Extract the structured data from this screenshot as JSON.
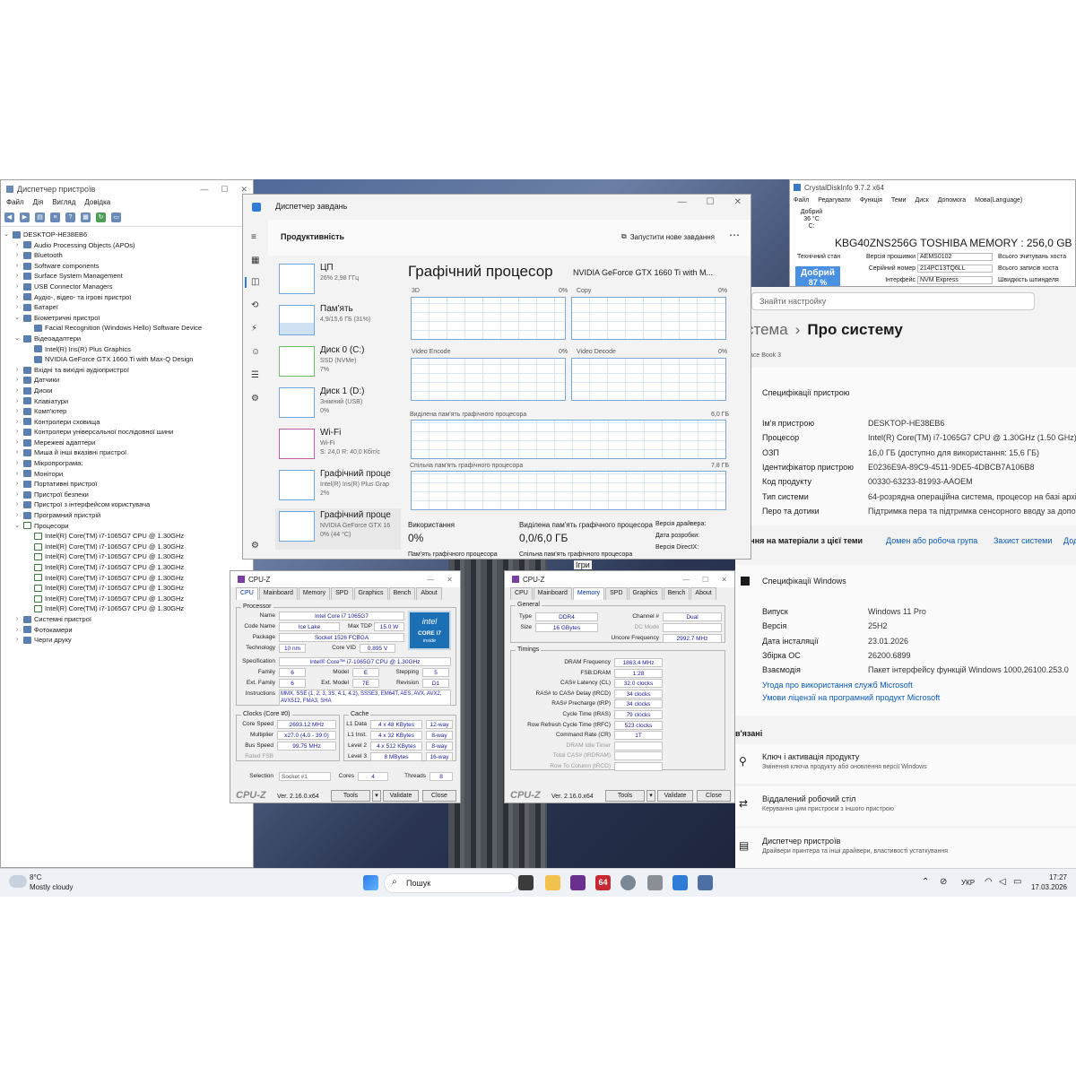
{
  "device_manager": {
    "title": "Диспетчер пристроїв",
    "menu": [
      "Файл",
      "Дія",
      "Вигляд",
      "Довідка"
    ],
    "tree": [
      {
        "label": "DESKTOP-HE38EB6",
        "level": 0,
        "toggle": "v",
        "icon": "computer-icon"
      },
      {
        "label": "Audio Processing Objects (APOs)",
        "level": 1,
        "toggle": ">",
        "icon": "audio-icon"
      },
      {
        "label": "Bluetooth",
        "level": 1,
        "toggle": ">",
        "icon": "bluetooth-icon"
      },
      {
        "label": "Software components",
        "level": 1,
        "toggle": ">",
        "icon": "component-icon"
      },
      {
        "label": "Surface System Management",
        "level": 1,
        "toggle": ">",
        "icon": "surface-icon"
      },
      {
        "label": "USB Connector Managers",
        "level": 1,
        "toggle": ">",
        "icon": "usb-icon"
      },
      {
        "label": "Аудіо-, відео- та ігрові пристрої",
        "level": 1,
        "toggle": ">",
        "icon": "speaker-icon"
      },
      {
        "label": "Батареї",
        "level": 1,
        "toggle": ">",
        "icon": "battery-icon"
      },
      {
        "label": "Біометричні пристрої",
        "level": 1,
        "toggle": "v",
        "icon": "biometric-icon"
      },
      {
        "label": "Facial Recognition (Windows Hello) Software Device",
        "level": 2,
        "toggle": "",
        "icon": "biometric-icon"
      },
      {
        "label": "Відеоадаптери",
        "level": 1,
        "toggle": "v",
        "icon": "display-adapter-icon"
      },
      {
        "label": "Intel(R) Iris(R) Plus Graphics",
        "level": 2,
        "toggle": "",
        "icon": "display-adapter-icon"
      },
      {
        "label": "NVIDIA GeForce GTX 1660 Ti with Max-Q Design",
        "level": 2,
        "toggle": "",
        "icon": "display-adapter-icon"
      },
      {
        "label": "Вхідні та вихідні аудіопристрої",
        "level": 1,
        "toggle": ">",
        "icon": "audio-io-icon"
      },
      {
        "label": "Датчики",
        "level": 1,
        "toggle": ">",
        "icon": "sensor-icon"
      },
      {
        "label": "Диски",
        "level": 1,
        "toggle": ">",
        "icon": "disk-icon"
      },
      {
        "label": "Клавіатури",
        "level": 1,
        "toggle": ">",
        "icon": "keyboard-icon"
      },
      {
        "label": "Комп'ютер",
        "level": 1,
        "toggle": ">",
        "icon": "computer-icon"
      },
      {
        "label": "Контролери сховища",
        "level": 1,
        "toggle": ">",
        "icon": "storage-icon"
      },
      {
        "label": "Контролери універсальної послідовної шини",
        "level": 1,
        "toggle": ">",
        "icon": "usb-icon"
      },
      {
        "label": "Мережеві адаптери",
        "level": 1,
        "toggle": ">",
        "icon": "network-icon"
      },
      {
        "label": "Миша й інші вказівні пристрої",
        "level": 1,
        "toggle": ">",
        "icon": "mouse-icon"
      },
      {
        "label": "Мікропрограма:",
        "level": 1,
        "toggle": ">",
        "icon": "firmware-icon"
      },
      {
        "label": "Монітори",
        "level": 1,
        "toggle": ">",
        "icon": "monitor-icon"
      },
      {
        "label": "Портативні пристрої",
        "level": 1,
        "toggle": ">",
        "icon": "portable-icon"
      },
      {
        "label": "Пристрої безпеки",
        "level": 1,
        "toggle": ">",
        "icon": "security-icon"
      },
      {
        "label": "Пристрої з інтерфейсом користувача",
        "level": 1,
        "toggle": ">",
        "icon": "hid-icon"
      },
      {
        "label": "Програмний пристрій",
        "level": 1,
        "toggle": ">",
        "icon": "software-device-icon"
      },
      {
        "label": "Процесори",
        "level": 1,
        "toggle": "v",
        "icon": "processor-icon"
      },
      {
        "label": "Intel(R) Core(TM) i7-1065G7 CPU @ 1.30GHz",
        "level": 2,
        "toggle": "",
        "icon": "processor-icon"
      },
      {
        "label": "Intel(R) Core(TM) i7-1065G7 CPU @ 1.30GHz",
        "level": 2,
        "toggle": "",
        "icon": "processor-icon"
      },
      {
        "label": "Intel(R) Core(TM) i7-1065G7 CPU @ 1.30GHz",
        "level": 2,
        "toggle": "",
        "icon": "processor-icon"
      },
      {
        "label": "Intel(R) Core(TM) i7-1065G7 CPU @ 1.30GHz",
        "level": 2,
        "toggle": "",
        "icon": "processor-icon"
      },
      {
        "label": "Intel(R) Core(TM) i7-1065G7 CPU @ 1.30GHz",
        "level": 2,
        "toggle": "",
        "icon": "processor-icon"
      },
      {
        "label": "Intel(R) Core(TM) i7-1065G7 CPU @ 1.30GHz",
        "level": 2,
        "toggle": "",
        "icon": "processor-icon"
      },
      {
        "label": "Intel(R) Core(TM) i7-1065G7 CPU @ 1.30GHz",
        "level": 2,
        "toggle": "",
        "icon": "processor-icon"
      },
      {
        "label": "Intel(R) Core(TM) i7-1065G7 CPU @ 1.30GHz",
        "level": 2,
        "toggle": "",
        "icon": "processor-icon"
      },
      {
        "label": "Системні пристрої",
        "level": 1,
        "toggle": ">",
        "icon": "system-icon"
      },
      {
        "label": "Фотокамери",
        "level": 1,
        "toggle": ">",
        "icon": "camera-icon"
      },
      {
        "label": "Черги друку",
        "level": 1,
        "toggle": ">",
        "icon": "printer-icon"
      }
    ]
  },
  "task_manager": {
    "title": "Диспетчер завдань",
    "page": "Продуктивність",
    "run_task": "Запустити нове завдання",
    "more": "⋯",
    "items": [
      {
        "name": "ЦП",
        "sub": "26% 2,98 ГГц",
        "sub2": ""
      },
      {
        "name": "Пам'ять",
        "sub": "4,9/15,6 ГБ (31%)",
        "sub2": ""
      },
      {
        "name": "Диск 0 (C:)",
        "sub": "SSD (NVMe)",
        "sub2": "7%"
      },
      {
        "name": "Диск 1 (D:)",
        "sub": "Знімний (USB)",
        "sub2": "0%"
      },
      {
        "name": "Wi-Fi",
        "sub": "Wi-Fi",
        "sub2": "S: 24,0 R: 40,0 Кбіт/с"
      },
      {
        "name": "Графічний проце",
        "sub": "Intel(R) Iris(R) Plus Grap",
        "sub2": "2%"
      },
      {
        "name": "Графічний проце",
        "sub": "NVIDIA GeForce GTX 16",
        "sub2": "0% (44 °C)"
      }
    ],
    "gpu": {
      "heading": "Графічний процесор",
      "model": "NVIDIA GeForce GTX 1660 Ti with M...",
      "g_3d": "3D",
      "g_3d_pct": "0%",
      "g_copy": "Copy",
      "g_copy_pct": "0%",
      "g_enc": "Video Encode",
      "g_enc_pct": "0%",
      "g_dec": "Video Decode",
      "g_dec_pct": "0%",
      "ded_label": "Виділена пам'ять графічного процесора",
      "ded_max": "6,0 ГБ",
      "shared_label": "Спільна пам'ять графічного процесора",
      "shared_max": "7,8 ГБ",
      "usage_label": "Використання",
      "usage": "0%",
      "ded_used_label": "Виділена пам'ять графічного процесора",
      "ded_used": "0,0/6,0 ГБ",
      "driver_ver": "Версія драйвера:",
      "driver_date": "Дата розробки:",
      "directx": "Версія DirectX:",
      "gpu_mem_label": "Пам'ять графічного процесора",
      "shared_mem_label2": "Спільна пам'ять графічного процесора"
    }
  },
  "crystal": {
    "title": "CrystalDiskInfo 9.7.2 x64",
    "menu": [
      "Файл",
      "Редагувати",
      "Функція",
      "Теми",
      "Диск",
      "Допомога",
      "Мова(Language)"
    ],
    "status_small": "Добрий",
    "temp_small": "36 °C",
    "drive_small": "C:",
    "model": "KBG40ZNS256G TOSHIBA MEMORY : 256,0 GB",
    "tech_state": "Технічний стан",
    "health": "Добрий",
    "health_pct": "87 %",
    "firmware_label": "Версія прошивки",
    "firmware": "AEMS0102",
    "serial_label": "Серійний номер",
    "serial": "214PC13TQ6LL",
    "interface_label": "Інтерфейс",
    "interface": "NVM Express",
    "host_reads": "Всього зчитувань хоста",
    "host_writes": "Всього записів хоста",
    "rpm": "Швидкість шпинделя"
  },
  "settings": {
    "search_placeholder": "Знайти настройку",
    "crumb_parent": "стема",
    "crumb_sep": "›",
    "crumb_current": "Про систему",
    "device_model": "ace Book 3",
    "device_specs_title": "Специфікації пристрою",
    "specs": [
      {
        "k": "Ім'я пристрою",
        "v": "DESKTOP-HE38EB6"
      },
      {
        "k": "Процесор",
        "v": "Intel(R) Core(TM) i7-1065G7 CPU @ 1.30GHz (1.50 GHz)"
      },
      {
        "k": "ОЗП",
        "v": "16,0 ГБ (доступно для використання: 15,6 ГБ)"
      },
      {
        "k": "Ідентифікатор пристрою",
        "v": "E0236E9A-89C9-4511-9DE5-4DBCB7A106B8"
      },
      {
        "k": "Код продукту",
        "v": "00330-63233-81993-AAOEM"
      },
      {
        "k": "Тип системи",
        "v": "64-розрядна операційна система, процесор на базі архі"
      },
      {
        "k": "Перо та дотики",
        "v": "Підтримка пера та підтримка сенсорного вводу за допо"
      }
    ],
    "related_label": "илання на матеріали з цієї теми",
    "related_links": [
      "Домен або робоча група",
      "Захист системи",
      "Дод"
    ],
    "windows_specs_title": "Специфікації Windows",
    "win_specs": [
      {
        "k": "Випуск",
        "v": "Windows 11 Pro"
      },
      {
        "k": "Версія",
        "v": "25H2"
      },
      {
        "k": "Дата інсталяції",
        "v": "23.01.2026"
      },
      {
        "k": "Збірка ОС",
        "v": "26200.6899"
      },
      {
        "k": "Взаємодія",
        "v": "Пакет інтерфейсу функцій Windows 1000.26100.253.0"
      }
    ],
    "ms_link1": "Угода про використання служб Microsoft",
    "ms_link2": "Умови ліцензії на програмний продукт Microsoft",
    "related_title": "в'язані",
    "related_items": [
      {
        "title": "Ключ і активація продукту",
        "sub": "Змінення ключа продукту або оновлення версії Windows"
      },
      {
        "title": "Віддалений робочий стіл",
        "sub": "Керування цим пристроєм з іншого пристрою"
      },
      {
        "title": "Диспетчер пристроїв",
        "sub": "Драйвери принтера та інші драйвери, властивості устаткування"
      }
    ],
    "games_label": "Ігри"
  },
  "cpuz1": {
    "title": "CPU-Z",
    "tabs": [
      "CPU",
      "Mainboard",
      "Memory",
      "SPD",
      "Graphics",
      "Bench",
      "About"
    ],
    "active_tab": "CPU",
    "processor_group": "Processor",
    "name_l": "Name",
    "name": "Intel Core i7 1065G7",
    "codename_l": "Code Name",
    "codename": "Ice Lake",
    "tdp_l": "Max TDP",
    "tdp": "15.0 W",
    "package_l": "Package",
    "package": "Socket 1526 FCBGA",
    "tech_l": "Technology",
    "tech": "10 nm",
    "vid_l": "Core VID",
    "vid": "0.895 V",
    "spec_l": "Specification",
    "spec": "Intel® Core™ i7-1065G7 CPU @ 1.30GHz",
    "family_l": "Family",
    "family": "6",
    "model_l": "Model",
    "model": "E",
    "stepping_l": "Stepping",
    "stepping": "5",
    "extfam_l": "Ext. Family",
    "extfam": "6",
    "extmod_l": "Ext. Model",
    "extmod": "7E",
    "rev_l": "Revision",
    "rev": "D1",
    "instr_l": "Instructions",
    "instr": "MMX, SSE (1, 2, 3, 3S, 4.1, 4.2), SSSE3, EM64T, AES, AVX, AVX2, AVX512, FMA3, SHA",
    "clocks_group": "Clocks (Core #0)",
    "cache_group": "Cache",
    "corespeed_l": "Core Speed",
    "corespeed": "2693.12 MHz",
    "mult_l": "Multiplier",
    "mult": "x27.0 (4.0 - 39.0)",
    "bus_l": "Bus Speed",
    "bus": "99.75 MHz",
    "fsb_l": "Rated FSB",
    "l1d_l": "L1 Data",
    "l1d": "4 x 48 KBytes",
    "l1d_w": "12-way",
    "l1i_l": "L1 Inst.",
    "l1i": "4 x 32 KBytes",
    "l1i_w": "8-way",
    "l2_l": "Level 2",
    "l2": "4 x 512 KBytes",
    "l2_w": "8-way",
    "l3_l": "Level 3",
    "l3": "8 MBytes",
    "l3_w": "16-way",
    "sel_l": "Selection",
    "sel": "Socket #1",
    "cores_l": "Cores",
    "cores": "4",
    "threads_l": "Threads",
    "threads": "8",
    "logo": "CPU-Z",
    "ver": "Ver. 2.16.0.x64",
    "tools": "Tools",
    "validate": "Validate",
    "close": "Close",
    "badge_intel": "intel",
    "badge_core": "CORE i7",
    "badge_inside": "inside"
  },
  "cpuz2": {
    "title": "CPU-Z",
    "tabs": [
      "CPU",
      "Mainboard",
      "Memory",
      "SPD",
      "Graphics",
      "Bench",
      "About"
    ],
    "active_tab": "Memory",
    "general_group": "General",
    "type_l": "Type",
    "type": "DDR4",
    "channel_l": "Channel #",
    "channel": "Dual",
    "size_l": "Size",
    "size": "16 GBytes",
    "dcmode_l": "DC Mode",
    "uncore_l": "Uncore Frequency",
    "uncore": "2992.7 MHz",
    "timings_group": "Timings",
    "dram_l": "DRAM Frequency",
    "dram": "1863.4 MHz",
    "fsb_l": "FSB:DRAM",
    "fsb": "1:28",
    "cas_l": "CAS# Latency (CL)",
    "cas": "32.0 clocks",
    "rcd_l": "RAS# to CAS# Delay (tRCD)",
    "rcd": "34 clocks",
    "rp_l": "RAS# Precharge (tRP)",
    "rp": "34 clocks",
    "ras_l": "Cycle Time (tRAS)",
    "ras": "79 clocks",
    "rfc_l": "Row Refresh Cycle Time (tRFC)",
    "rfc": "523 clocks",
    "cr_l": "Command Rate (CR)",
    "cr": "1T",
    "idle_l": "DRAM Idle Timer",
    "trdram_l": "Total CAS# (tRDRAM)",
    "rtc_l": "Row To Column (tRCD)",
    "logo": "CPU-Z",
    "ver": "Ver. 2.16.0.x64",
    "tools": "Tools",
    "validate": "Validate",
    "close": "Close"
  },
  "taskbar": {
    "weather_temp": "8°C",
    "weather_desc": "Mostly cloudy",
    "search": "Пошук",
    "lang": "УКР",
    "time": "17:27",
    "date": "17.03.2026",
    "app_badge": "64"
  }
}
